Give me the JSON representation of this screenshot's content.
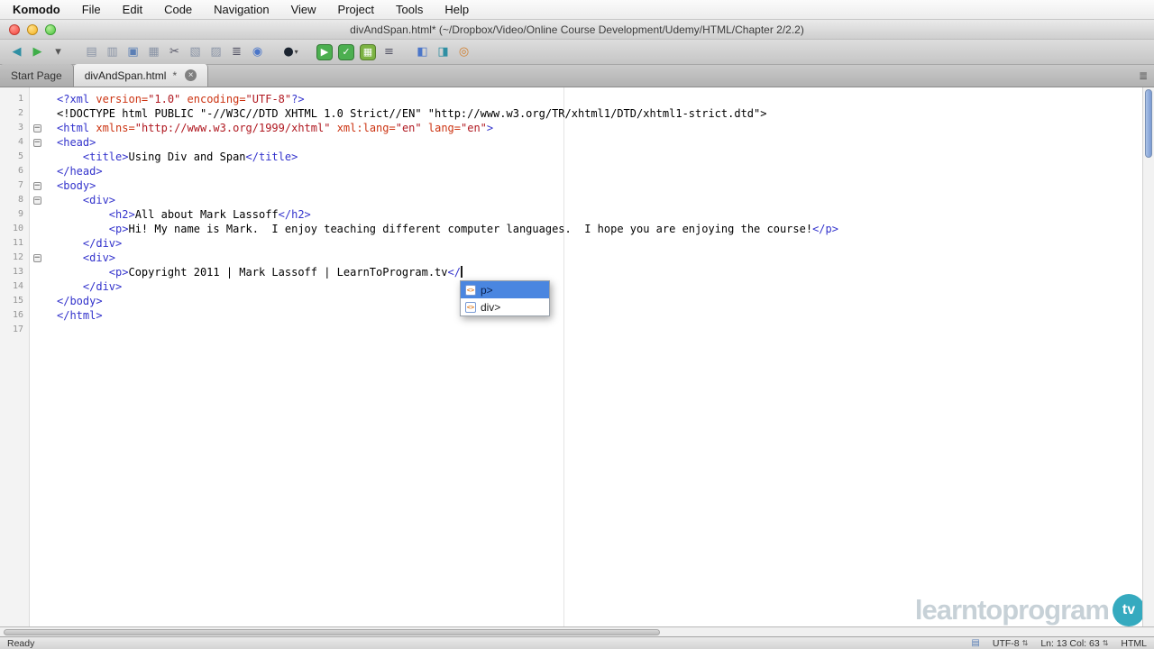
{
  "colors": {
    "tag": "#3333cc",
    "attribute": "#cc3311",
    "string": "#b01820",
    "selection": "#4a86e0",
    "watermark_teal": "#35aabf"
  },
  "icons": {
    "stepper": "⇅",
    "tab_close": "×",
    "tab_list": "≣",
    "element": "<>",
    "fold_collapse": "−"
  },
  "menu_bar": {
    "items": [
      "Komodo",
      "File",
      "Edit",
      "Code",
      "Navigation",
      "View",
      "Project",
      "Tools",
      "Help"
    ]
  },
  "window": {
    "title": "divAndSpan.html* (~/Dropbox/Video/Online Course Development/Udemy/HTML/Chapter 2/2.2)"
  },
  "toolbar": {
    "buttons": [
      {
        "name": "back-button",
        "icon": "back-icon",
        "glyph": "◀",
        "fg": "#2f8fa3"
      },
      {
        "name": "forward-button",
        "icon": "forward-icon",
        "glyph": "▶",
        "fg": "#3fae49"
      },
      {
        "name": "history-dropdown",
        "icon": "chevron-down-icon",
        "glyph": "▾",
        "fg": "#555"
      },
      {
        "sep": true
      },
      {
        "name": "new-file-button",
        "icon": "new-file-icon",
        "glyph": "▤",
        "fg": "#8a94a6"
      },
      {
        "name": "open-file-button",
        "icon": "open-file-icon",
        "glyph": "▥",
        "fg": "#8a94a6"
      },
      {
        "name": "save-button",
        "icon": "save-icon",
        "glyph": "▣",
        "fg": "#5b7fb5"
      },
      {
        "name": "save-all-button",
        "icon": "save-all-icon",
        "glyph": "▦",
        "fg": "#8a94a6"
      },
      {
        "name": "cut-button",
        "icon": "scissors-icon",
        "glyph": "✂",
        "fg": "#556"
      },
      {
        "name": "copy-button",
        "icon": "copy-icon",
        "glyph": "▧",
        "fg": "#8a94a6"
      },
      {
        "name": "paste-button",
        "icon": "paste-icon",
        "glyph": "▨",
        "fg": "#8a94a6"
      },
      {
        "name": "print-button",
        "icon": "printer-icon",
        "glyph": "≣",
        "fg": "#556"
      },
      {
        "name": "preview-button",
        "icon": "preview-icon",
        "glyph": "◉",
        "fg": "#4b76c9"
      },
      {
        "sep": true
      },
      {
        "name": "macro-record-dropdown",
        "icon": "record-sphere-icon",
        "glyph": "●",
        "fg": "#1b2430",
        "extra": "▾"
      },
      {
        "sep": true
      },
      {
        "name": "run-command-button",
        "icon": "run-icon",
        "glyph": "▶",
        "bg": "#4caf50"
      },
      {
        "name": "check-syntax-button",
        "icon": "check-icon",
        "glyph": "✓",
        "bg": "#4caf50"
      },
      {
        "name": "new-tool-button",
        "icon": "grid-icon",
        "glyph": "▦",
        "bg": "#7cb342"
      },
      {
        "name": "toolbox-button",
        "icon": "list-icon",
        "glyph": "≡",
        "fg": "#556"
      },
      {
        "sep": true
      },
      {
        "name": "preview-browser-button",
        "icon": "browser-pane-icon",
        "glyph": "◧",
        "fg": "#4b76c9"
      },
      {
        "name": "split-view-button",
        "icon": "split-pane-icon",
        "glyph": "◨",
        "fg": "#2f8fa3"
      },
      {
        "name": "colors-button",
        "icon": "color-wheel-icon",
        "glyph": "◎",
        "fg": "#d07f2f"
      }
    ]
  },
  "tabs": [
    {
      "name": "tab-start-page",
      "label": "Start Page",
      "active": false,
      "closable": false
    },
    {
      "name": "tab-divandspan",
      "label": "divAndSpan.html",
      "modified": "*",
      "active": true,
      "closable": true
    }
  ],
  "editor": {
    "lines": [
      {
        "n": 1,
        "segments": [
          [
            "t",
            "<?xml "
          ],
          [
            "a",
            "version="
          ],
          [
            "s",
            "\"1.0\""
          ],
          [
            "k",
            " "
          ],
          [
            "a",
            "encoding="
          ],
          [
            "s",
            "\"UTF-8\""
          ],
          [
            "t",
            "?>"
          ]
        ]
      },
      {
        "n": 2,
        "segments": [
          [
            "k",
            "<!DOCTYPE html PUBLIC \"-//W3C//DTD XHTML 1.0 Strict//EN\" \"http://www.w3.org/TR/xhtml1/DTD/xhtml1-strict.dtd\">"
          ]
        ]
      },
      {
        "n": 3,
        "fold": true,
        "segments": [
          [
            "t",
            "<html "
          ],
          [
            "a",
            "xmlns="
          ],
          [
            "s",
            "\"http://www.w3.org/1999/xhtml\""
          ],
          [
            "k",
            " "
          ],
          [
            "a",
            "xml:lang="
          ],
          [
            "s",
            "\"en\""
          ],
          [
            "k",
            " "
          ],
          [
            "a",
            "lang="
          ],
          [
            "s",
            "\"en\""
          ],
          [
            "t",
            ">"
          ]
        ]
      },
      {
        "n": 4,
        "fold": true,
        "segments": [
          [
            "t",
            "<head>"
          ]
        ]
      },
      {
        "n": 5,
        "segments": [
          [
            "k",
            "    "
          ],
          [
            "t",
            "<title>"
          ],
          [
            "k",
            "Using Div and Span"
          ],
          [
            "t",
            "</title>"
          ]
        ]
      },
      {
        "n": 6,
        "segments": [
          [
            "t",
            "</head>"
          ]
        ]
      },
      {
        "n": 7,
        "fold": true,
        "segments": [
          [
            "t",
            "<body>"
          ]
        ]
      },
      {
        "n": 8,
        "fold": true,
        "segments": [
          [
            "k",
            "    "
          ],
          [
            "t",
            "<div>"
          ]
        ]
      },
      {
        "n": 9,
        "segments": [
          [
            "k",
            "        "
          ],
          [
            "t",
            "<h2>"
          ],
          [
            "k",
            "All about Mark Lassoff"
          ],
          [
            "t",
            "</h2>"
          ]
        ]
      },
      {
        "n": 10,
        "segments": [
          [
            "k",
            "        "
          ],
          [
            "t",
            "<p>"
          ],
          [
            "k",
            "Hi! My name is Mark.  I enjoy teaching different computer languages.  I hope you are enjoying the course!"
          ],
          [
            "t",
            "</p>"
          ]
        ]
      },
      {
        "n": 11,
        "segments": [
          [
            "k",
            "    "
          ],
          [
            "t",
            "</div>"
          ]
        ]
      },
      {
        "n": 12,
        "fold": true,
        "segments": [
          [
            "k",
            "    "
          ],
          [
            "t",
            "<div>"
          ]
        ]
      },
      {
        "n": 13,
        "caret": true,
        "segments": [
          [
            "k",
            "        "
          ],
          [
            "t",
            "<p>"
          ],
          [
            "k",
            "Copyright 2011 | Mark Lassoff | LearnToProgram.tv"
          ],
          [
            "t",
            "</"
          ]
        ]
      },
      {
        "n": 14,
        "segments": [
          [
            "k",
            "    "
          ],
          [
            "t",
            "</div>"
          ]
        ]
      },
      {
        "n": 15,
        "segments": [
          [
            "t",
            "</body>"
          ]
        ]
      },
      {
        "n": 16,
        "segments": [
          [
            "t",
            "</html>"
          ]
        ]
      },
      {
        "n": 17,
        "segments": []
      }
    ]
  },
  "autocomplete": {
    "items": [
      {
        "label": "p>",
        "selected": true
      },
      {
        "label": "div>",
        "selected": false
      }
    ]
  },
  "statusbar": {
    "status": "Ready",
    "encoding": "UTF-8",
    "position": "Ln: 13 Col: 63",
    "language": "HTML"
  },
  "watermark": {
    "text": "learntoprogram",
    "badge": "tv"
  }
}
